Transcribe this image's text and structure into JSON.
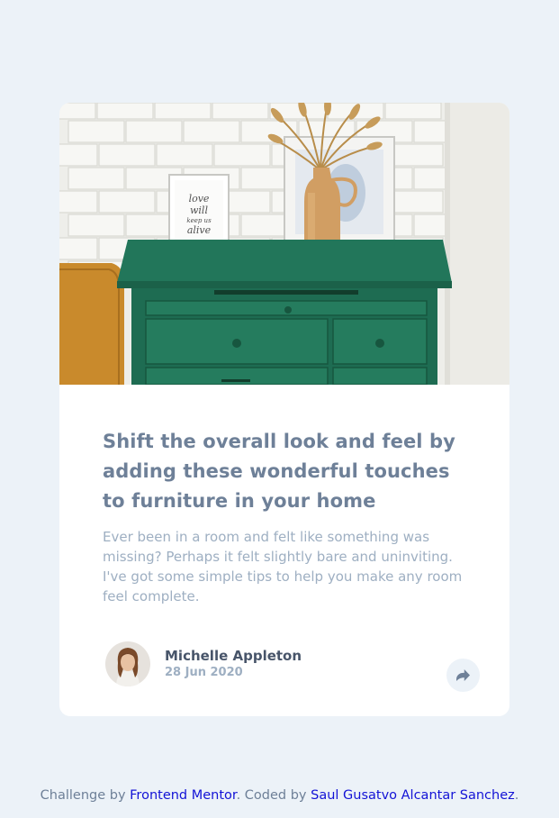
{
  "card": {
    "image_alt": "Green drawers with vase and picture frames",
    "frame_text": "love will keep us alive",
    "title": "Shift the overall look and feel by\nadding these wonderful touches\nto furniture in your home",
    "excerpt": "Ever been in a room and felt like something was\nmissing? Perhaps it felt slightly bare and uninviting.\nI've got some simple tips to help you make any room\nfeel complete.",
    "author": {
      "name": "Michelle Appleton",
      "date": "28 Jun 2020"
    },
    "share_icon": "share-icon"
  },
  "attribution": {
    "prefix": "Challenge by ",
    "challenge_link": "Frontend Mentor",
    "middle": ". Coded by ",
    "coder_link": "Saul Gusatvo Alcantar Sanchez",
    "suffix": "."
  },
  "colors": {
    "background": "#ecf2f8",
    "title": "#6e8098",
    "text": "#9eafc2",
    "author": "#48556a",
    "link": "#1313d6"
  }
}
